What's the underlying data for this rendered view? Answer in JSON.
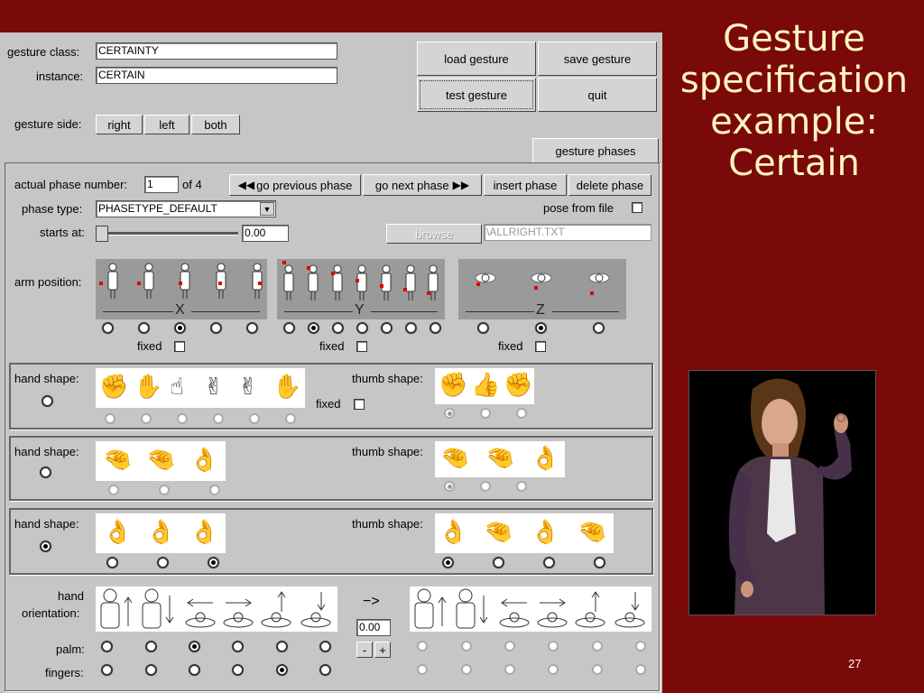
{
  "slide": {
    "title_lines": [
      "Gesture",
      "specification",
      "example:",
      "Certain"
    ],
    "page_number": "27"
  },
  "form": {
    "gesture_class_label": "gesture class:",
    "gesture_class_value": "CERTAINTY",
    "instance_label": "instance:",
    "instance_value": "CERTAIN",
    "gesture_side_label": "gesture side:",
    "side_buttons": [
      "right",
      "left",
      "both"
    ]
  },
  "top_buttons": {
    "load": "load gesture",
    "save": "save gesture",
    "test": "test gesture",
    "quit": "quit"
  },
  "tab": {
    "label": "gesture phases"
  },
  "phase": {
    "number_label": "actual phase number:",
    "number_value": "1",
    "of_label": "of 4",
    "prev_label": "go previous phase",
    "next_label": "go next phase",
    "insert_label": "insert phase",
    "delete_label": "delete phase",
    "type_label": "phase type:",
    "type_value": "PHASETYPE_DEFAULT",
    "pose_from_file_label": "pose from file",
    "starts_label": "starts at:",
    "starts_value": "0.00",
    "starts_slider_fraction": 0,
    "browse_label": "browse",
    "file_value": "\\ALLRIGHT.TXT"
  },
  "arm_position": {
    "label": "arm position:",
    "fixed_label": "fixed",
    "x": {
      "axis": "X",
      "options": 5,
      "selected": 2
    },
    "y": {
      "axis": "Y",
      "options": 7,
      "selected": 1
    },
    "z": {
      "axis": "Z",
      "options": 3,
      "selected": 1
    }
  },
  "hand_rows": [
    {
      "hand_label": "hand shape:",
      "thumb_label": "thumb shape:",
      "fixed_label": "fixed",
      "hand_selected_main": false,
      "hand_options": 6,
      "hand_selected": -1,
      "thumb_options": 3,
      "thumb_selected": 0,
      "active": false
    },
    {
      "hand_label": "hand shape:",
      "thumb_label": "thumb shape:",
      "hand_selected_main": false,
      "hand_options": 3,
      "hand_selected": -1,
      "thumb_options": 3,
      "thumb_selected": 0,
      "active": false
    },
    {
      "hand_label": "hand shape:",
      "thumb_label": "thumb shape:",
      "hand_selected_main": true,
      "hand_options": 3,
      "hand_selected": 2,
      "thumb_options": 4,
      "thumb_selected": 0,
      "active": true
    }
  ],
  "orientation": {
    "label_line1": "hand",
    "label_line2": "orientation:",
    "arrow_label": "−>",
    "value": "0.00",
    "minus_label": "-",
    "plus_label": "+",
    "palm_label": "palm:",
    "fingers_label": "fingers:",
    "palm_selected": 2,
    "fingers_selected": 4
  }
}
